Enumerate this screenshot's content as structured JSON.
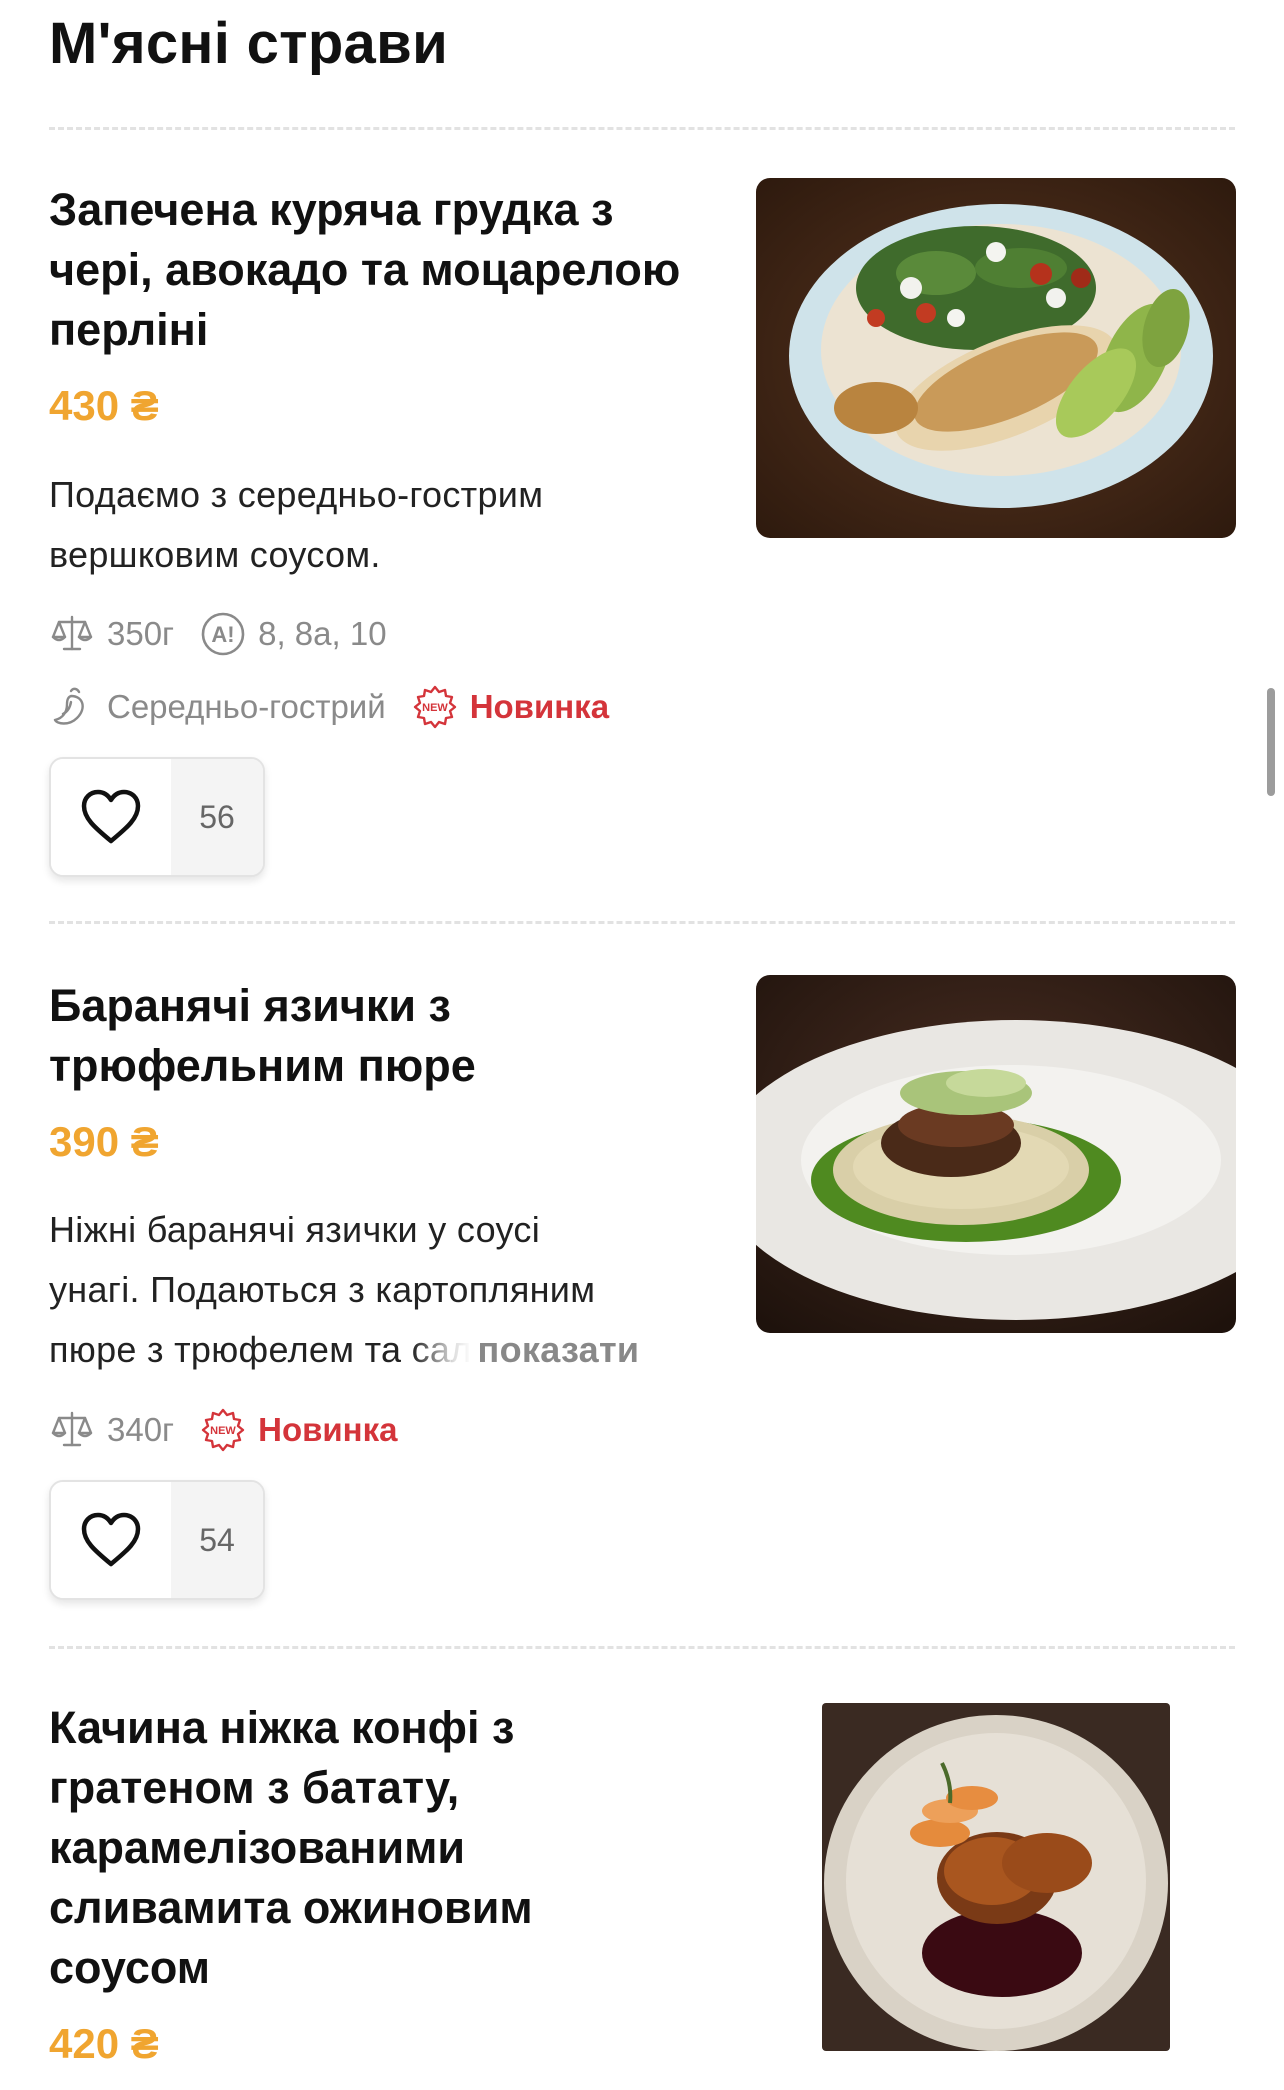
{
  "section": {
    "title": "М'ясні страви"
  },
  "items": [
    {
      "name": "Запечена куряча грудка з чері, авокадо та моцарелою перліні",
      "price": "430 ₴",
      "description": "Подаємо з середньо-гострим вершковим соусом.",
      "weight": "350г",
      "allergens": "8, 8а, 10",
      "spicy": "Середньо-гострий",
      "badge": "Новинка",
      "likes": "56"
    },
    {
      "name": "Баранячі язички з трюфельним пюре",
      "price": "390 ₴",
      "description_line1": "Ніжні баранячі язички у соусі",
      "description_line2": "унагі. Подаються з картопляним",
      "description_line3_main": "пюре з трюфелем та",
      "description_line3_fade": "сал",
      "show_more": "показати",
      "weight": "340г",
      "badge": "Новинка",
      "likes": "54"
    },
    {
      "name": "Качина ніжка конфі з гратеном з батату, карамелізованими сливамита ожиновим соусом",
      "price": "420 ₴"
    }
  ],
  "colors": {
    "price": "#f0a530",
    "badge": "#d4343a",
    "meta": "#8a8a8a"
  },
  "icons": [
    "scales-icon",
    "allergen-icon",
    "chili-icon",
    "new-badge-icon",
    "heart-icon"
  ]
}
